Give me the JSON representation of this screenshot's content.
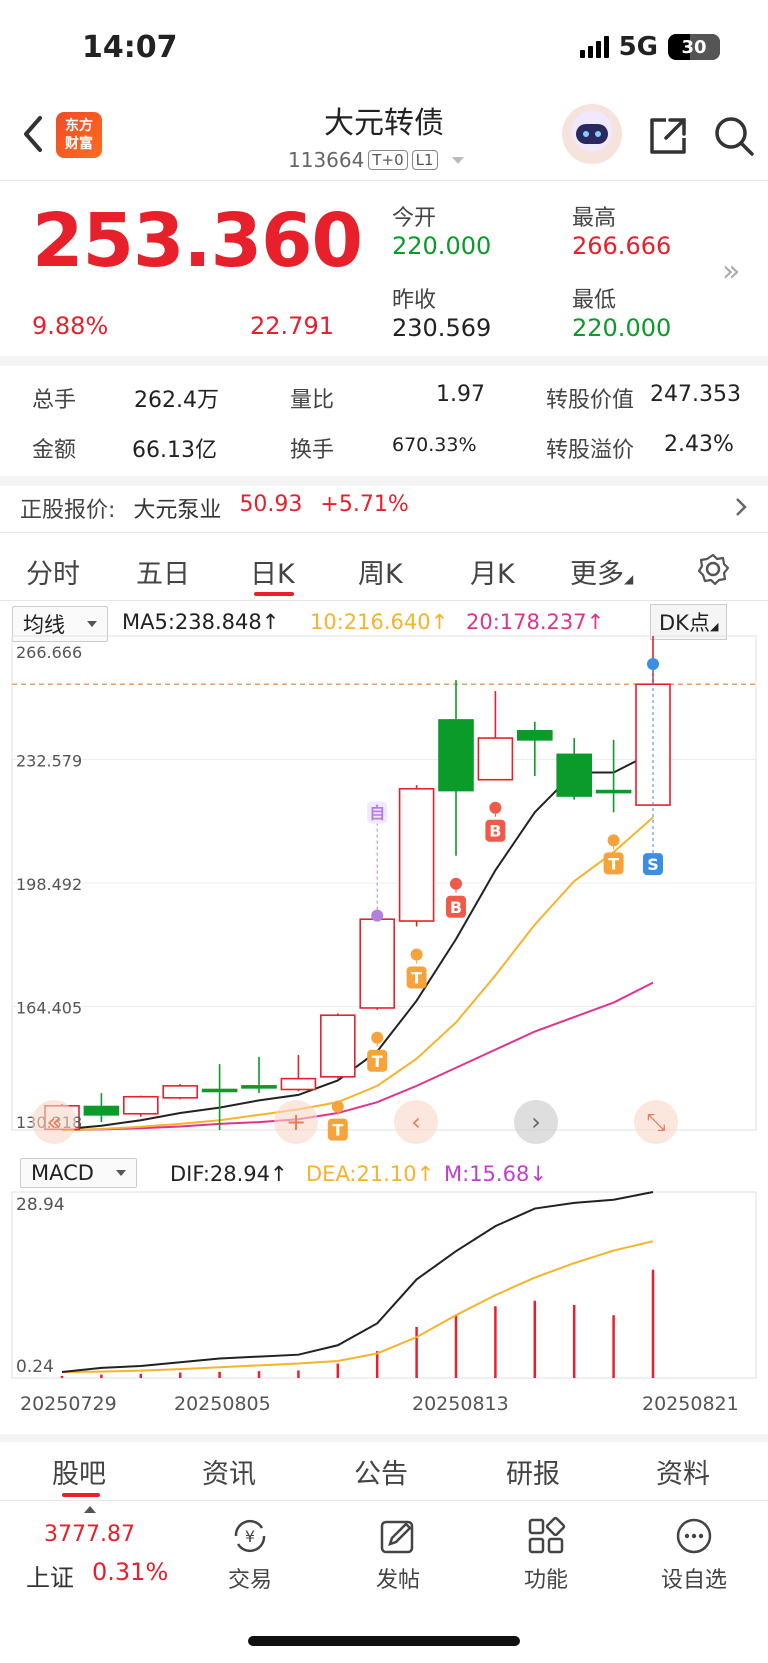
{
  "status": {
    "time": "14:07",
    "network": "5G",
    "battery": "30"
  },
  "header": {
    "logo_text": "东方\n财富",
    "name": "大元转债",
    "code": "113664",
    "tags": [
      "T+0",
      "L1"
    ]
  },
  "quote": {
    "price": "253.360",
    "pct": "9.88%",
    "change": "22.791",
    "open_label": "今开",
    "open": "220.000",
    "high_label": "最高",
    "high": "266.666",
    "prev_label": "昨收",
    "prev": "230.569",
    "low_label": "最低",
    "low": "220.000"
  },
  "stats": {
    "vol_label": "总手",
    "vol": "262.4万",
    "ratio_label": "量比",
    "ratio": "1.97",
    "conv_value_label": "转股价值",
    "conv_value": "247.353",
    "amount_label": "金额",
    "amount": "66.13亿",
    "turnover_label": "换手",
    "turnover": "670.33%",
    "premium_label": "转股溢价",
    "premium": "2.43%"
  },
  "underlying": {
    "label": "正股报价:",
    "name": "大元泵业",
    "price": "50.93",
    "pct": "+5.71%"
  },
  "period_tabs": [
    "分时",
    "五日",
    "日K",
    "周K",
    "月K",
    "更多"
  ],
  "active_tab": "日K",
  "ma": {
    "select": "均线",
    "ma5": "MA5:238.848↑",
    "ma10": "10:216.640↑",
    "ma20": "20:178.237↑",
    "dk": "DK点"
  },
  "macd": {
    "select": "MACD",
    "dif": "DIF:28.94↑",
    "dea": "DEA:21.10↑",
    "m": "M:15.68↓"
  },
  "colors": {
    "up": "#e8202b",
    "down": "#0a9b2a",
    "ma5": "#222222",
    "ma10": "#f7b32b",
    "ma20": "#e0338f"
  },
  "chart_data": {
    "type": "candlestick",
    "y_axis_labels": [
      "266.666",
      "232.579",
      "198.492",
      "164.405",
      "130.318"
    ],
    "ylim": [
      130.318,
      266.666
    ],
    "x_labels": [
      "20250729",
      "20250805",
      "20250813",
      "20250821"
    ],
    "candles": [
      {
        "o": 130.5,
        "c": 137.0,
        "h": 137.5,
        "l": 130.3,
        "up": true
      },
      {
        "o": 136.8,
        "c": 134.5,
        "h": 140.5,
        "l": 132.5,
        "up": false
      },
      {
        "o": 134.8,
        "c": 139.5,
        "h": 139.8,
        "l": 134.0,
        "up": true
      },
      {
        "o": 139.2,
        "c": 142.5,
        "h": 143.0,
        "l": 138.8,
        "up": true
      },
      {
        "o": 141.5,
        "c": 141.0,
        "h": 148.5,
        "l": 130.3,
        "up": false
      },
      {
        "o": 142.5,
        "c": 142.0,
        "h": 150.5,
        "l": 140.5,
        "up": false
      },
      {
        "o": 141.5,
        "c": 144.5,
        "h": 151.0,
        "l": 141.0,
        "up": true
      },
      {
        "o": 145.0,
        "c": 162.0,
        "h": 162.5,
        "l": 144.5,
        "up": true
      },
      {
        "o": 164.0,
        "c": 188.5,
        "h": 189.5,
        "l": 163.5,
        "up": true
      },
      {
        "o": 188.0,
        "c": 224.5,
        "h": 225.5,
        "l": 186.5,
        "up": true
      },
      {
        "o": 243.5,
        "c": 224.0,
        "h": 254.5,
        "l": 206.0,
        "up": false
      },
      {
        "o": 227.0,
        "c": 238.5,
        "h": 251.5,
        "l": 227.0,
        "up": true
      },
      {
        "o": 240.5,
        "c": 238.0,
        "h": 243.0,
        "l": 228.0,
        "up": false
      },
      {
        "o": 234.0,
        "c": 222.5,
        "h": 238.5,
        "l": 221.5,
        "up": false
      },
      {
        "o": 224.0,
        "c": 224.0,
        "h": 238.0,
        "l": 218.0,
        "up": false
      },
      {
        "o": 220.0,
        "c": 253.36,
        "h": 266.666,
        "l": 220.0,
        "up": true
      }
    ],
    "ma5": [
      130.5,
      131.5,
      133.0,
      135.0,
      136.5,
      138.5,
      140.0,
      144.0,
      152.0,
      166.0,
      183.0,
      202.0,
      218.0,
      229.0,
      229.0,
      234.5
    ],
    "ma10": [
      130.3,
      130.6,
      131.2,
      132.0,
      133.0,
      134.5,
      136.0,
      138.0,
      142.5,
      150.0,
      160.0,
      173.0,
      187.0,
      199.0,
      207.0,
      216.6
    ],
    "ma20": [
      130.3,
      130.5,
      130.8,
      131.3,
      132.0,
      132.5,
      133.3,
      135.0,
      138.0,
      142.5,
      147.5,
      152.5,
      157.5,
      161.5,
      165.5,
      171.0
    ],
    "macd": {
      "ylabels": [
        "28.94",
        "0.24"
      ],
      "ylim": [
        0.24,
        28.94
      ],
      "dif": [
        0.24,
        0.9,
        1.2,
        1.8,
        2.4,
        2.7,
        3.0,
        4.5,
        8.0,
        15.0,
        19.5,
        23.5,
        26.3,
        27.2,
        27.7,
        28.94
      ],
      "dea": [
        0.24,
        0.3,
        0.45,
        0.7,
        1.0,
        1.3,
        1.6,
        2.0,
        3.2,
        5.8,
        9.3,
        12.5,
        15.3,
        17.6,
        19.6,
        21.1
      ],
      "m": [
        0.3,
        0.5,
        0.6,
        0.8,
        0.9,
        1.0,
        1.1,
        2.1,
        3.9,
        7.4,
        9.2,
        10.4,
        11.2,
        10.6,
        9.1,
        15.68
      ]
    },
    "markers": [
      {
        "i": 7,
        "text": "T"
      },
      {
        "i": 8,
        "text": "T"
      },
      {
        "i": 9,
        "text": "T"
      },
      {
        "i": 10,
        "text": "B"
      },
      {
        "i": 11,
        "text": "B"
      },
      {
        "i": 14,
        "text": "T"
      },
      {
        "i": 15,
        "text": "S"
      },
      {
        "i": 8,
        "text": "自"
      }
    ]
  },
  "chart_nav": [
    "«",
    "+",
    "‹",
    "›",
    "⤡"
  ],
  "bottom_tabs": [
    "股吧",
    "资讯",
    "公告",
    "研报",
    "资料"
  ],
  "index": {
    "value": "3777.87",
    "name": "上证",
    "pct": "0.31%"
  },
  "nav": [
    "交易",
    "发帖",
    "功能",
    "设自选"
  ]
}
